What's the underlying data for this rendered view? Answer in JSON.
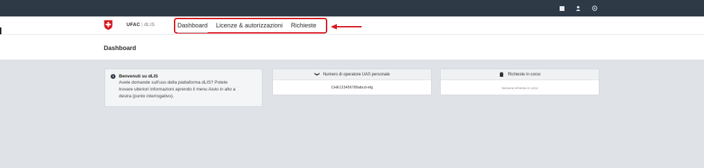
{
  "topbar": {
    "icons": [
      "grid-icon",
      "user-icon",
      "help-icon"
    ]
  },
  "brand": {
    "org": "UFAC",
    "separator": "|",
    "app": "dLIS"
  },
  "nav": {
    "items": [
      {
        "label": "Dashboard",
        "active": true
      },
      {
        "label": "Licenze & autorizzazioni",
        "active": false
      },
      {
        "label": "Richieste",
        "active": false
      }
    ]
  },
  "page": {
    "title": "Dashboard"
  },
  "welcome_card": {
    "title": "Benvenuti su dLIS",
    "text_lines": [
      "Avete domande sull'uso della piattaforma dLIS? Potete",
      "trovare ulteriori informazioni aprendo il menu Aiuto in alto a",
      "destra (punto interrogativo)."
    ]
  },
  "uas_card": {
    "header": "Numero di operatore UAS personale",
    "value": "CHE123456789abcd-efg"
  },
  "requests_card": {
    "header": "Richieste in corso",
    "value": "Nessuna richiesta in corso"
  },
  "colors": {
    "topbar": "#2e3a46",
    "highlight": "#d71920",
    "background": "#dfe3e8"
  }
}
